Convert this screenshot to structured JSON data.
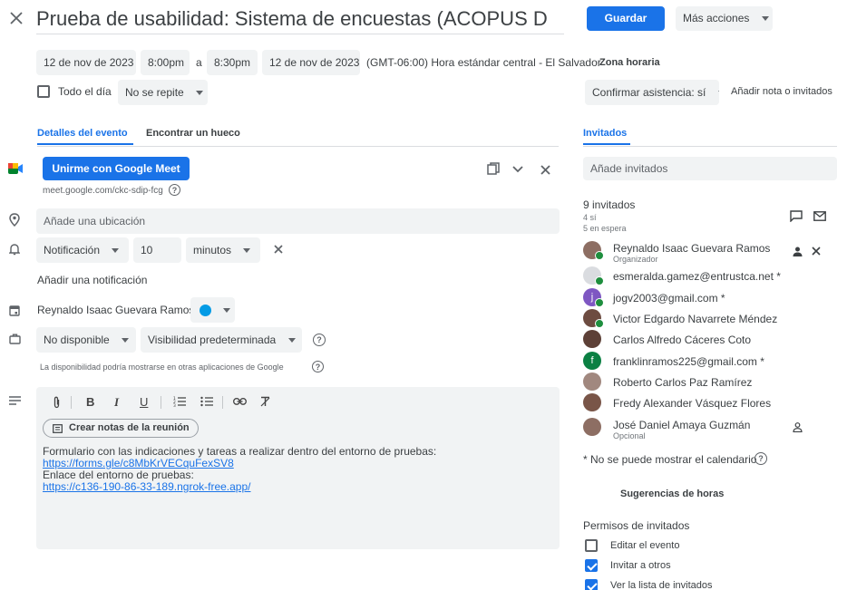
{
  "header": {
    "title": "Prueba de usabilidad: Sistema de encuestas (ACOPUS D",
    "save_label": "Guardar",
    "more_actions_label": "Más acciones"
  },
  "datetime": {
    "start_date": "12 de nov de 2023",
    "start_time": "8:00pm",
    "separator": "a",
    "end_time": "8:30pm",
    "end_date": "12 de nov de 2023",
    "timezone_text": "(GMT-06:00) Hora estándar central - El Salvador",
    "timezone_link": "Zona horaria"
  },
  "options": {
    "all_day_label": "Todo el día",
    "repeat_value": "No se repite"
  },
  "rsvp": {
    "confirm_label": "Confirmar asistencia: sí",
    "add_note_label": "Añadir nota o invitados"
  },
  "tabs": {
    "details": "Detalles del evento",
    "find_slot": "Encontrar un hueco",
    "guests": "Invitados"
  },
  "meet": {
    "button_label": "Unirme con Google Meet",
    "link": "meet.google.com/ckc-sdip-fcg"
  },
  "location": {
    "placeholder": "Añade una ubicación"
  },
  "notification": {
    "type": "Notificación",
    "amount": "10",
    "unit": "minutos",
    "add_label": "Añadir una notificación"
  },
  "calendar": {
    "owner": "Reynaldo Isaac Guevara Ramos",
    "color": "#039be5"
  },
  "availability": {
    "busy_value": "No disponible",
    "visibility_value": "Visibilidad predeterminada",
    "note": "La disponibilidad podría mostrarse en otras aplicaciones de Google"
  },
  "description": {
    "meeting_notes_label": "Crear notas de la reunión",
    "line1": "Formulario con las indicaciones y tareas a realizar dentro del entorno de pruebas:",
    "link1": "https://forms.gle/c8MbKrVECquFexSV8",
    "line2": "Enlace del entorno de pruebas:",
    "link2": "https://c136-190-86-33-189.ngrok-free.app/"
  },
  "guests_panel": {
    "add_placeholder": "Añade invitados",
    "count_label": "9 invitados",
    "yes_count": "4 sí",
    "waiting_count": "5 en espera",
    "list": [
      {
        "name": "Reynaldo Isaac Guevara Ramos",
        "sub": "Organizador",
        "avatar_color": "#8d6e63",
        "accepted": true
      },
      {
        "name": "esmeralda.gamez@entrustca.net *",
        "sub": "",
        "avatar_color": "#dadce0",
        "accepted": true
      },
      {
        "name": "jogv2003@gmail.com *",
        "sub": "",
        "avatar_color": "#7e57c2",
        "accepted": true,
        "initial": "j"
      },
      {
        "name": "Victor Edgardo Navarrete Méndez",
        "sub": "",
        "avatar_color": "#6d4c41",
        "accepted": true
      },
      {
        "name": "Carlos Alfredo Cáceres Coto",
        "sub": "",
        "avatar_color": "#5d4037",
        "accepted": false
      },
      {
        "name": "franklinramos225@gmail.com *",
        "sub": "",
        "avatar_color": "#0b8043",
        "accepted": false,
        "initial": "f"
      },
      {
        "name": "Roberto Carlos Paz Ramírez",
        "sub": "",
        "avatar_color": "#a1887f",
        "accepted": false
      },
      {
        "name": "Fredy Alexander Vásquez Flores",
        "sub": "",
        "avatar_color": "#795548",
        "accepted": false
      },
      {
        "name": "José Daniel Amaya Guzmán",
        "sub": "Opcional",
        "avatar_color": "#8d6e63",
        "accepted": false
      }
    ],
    "calendar_note": "* No se puede mostrar el calendario",
    "suggestions_label": "Sugerencias de horas",
    "permissions_title": "Permisos de invitados",
    "permissions": [
      {
        "label": "Editar el evento",
        "checked": false
      },
      {
        "label": "Invitar a otros",
        "checked": true
      },
      {
        "label": "Ver la lista de invitados",
        "checked": true
      }
    ]
  },
  "colors": {
    "accent": "#1a73e8",
    "chip_bg": "#f1f3f4",
    "accept_green": "#1e8e3e"
  }
}
